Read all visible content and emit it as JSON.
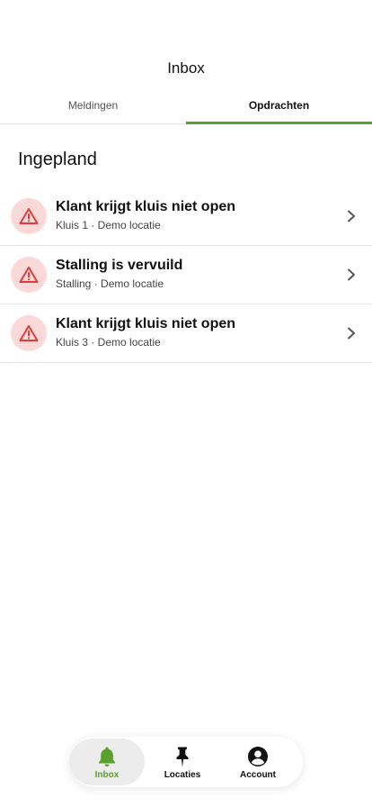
{
  "header": {
    "title": "Inbox"
  },
  "tabs": [
    {
      "label": "Meldingen",
      "active": false
    },
    {
      "label": "Opdrachten",
      "active": true
    }
  ],
  "section": {
    "title": "Ingepland"
  },
  "items": [
    {
      "title": "Klant krijgt kluis niet open",
      "subtitle": "Kluis 1 · Demo locatie",
      "icon": "warning-triangle-icon"
    },
    {
      "title": "Stalling is vervuild",
      "subtitle": "Stalling · Demo locatie",
      "icon": "warning-triangle-icon"
    },
    {
      "title": "Klant krijgt kluis niet open",
      "subtitle": "Kluis 3 · Demo locatie",
      "icon": "warning-triangle-icon"
    }
  ],
  "nav": [
    {
      "label": "Inbox",
      "icon": "bell-icon",
      "active": true
    },
    {
      "label": "Locaties",
      "icon": "pin-icon",
      "active": false
    },
    {
      "label": "Account",
      "icon": "account-icon",
      "active": false
    }
  ],
  "colors": {
    "accent": "#5aa02c",
    "alert": "#e03c3c",
    "alert_bg": "#fcd9d9"
  }
}
